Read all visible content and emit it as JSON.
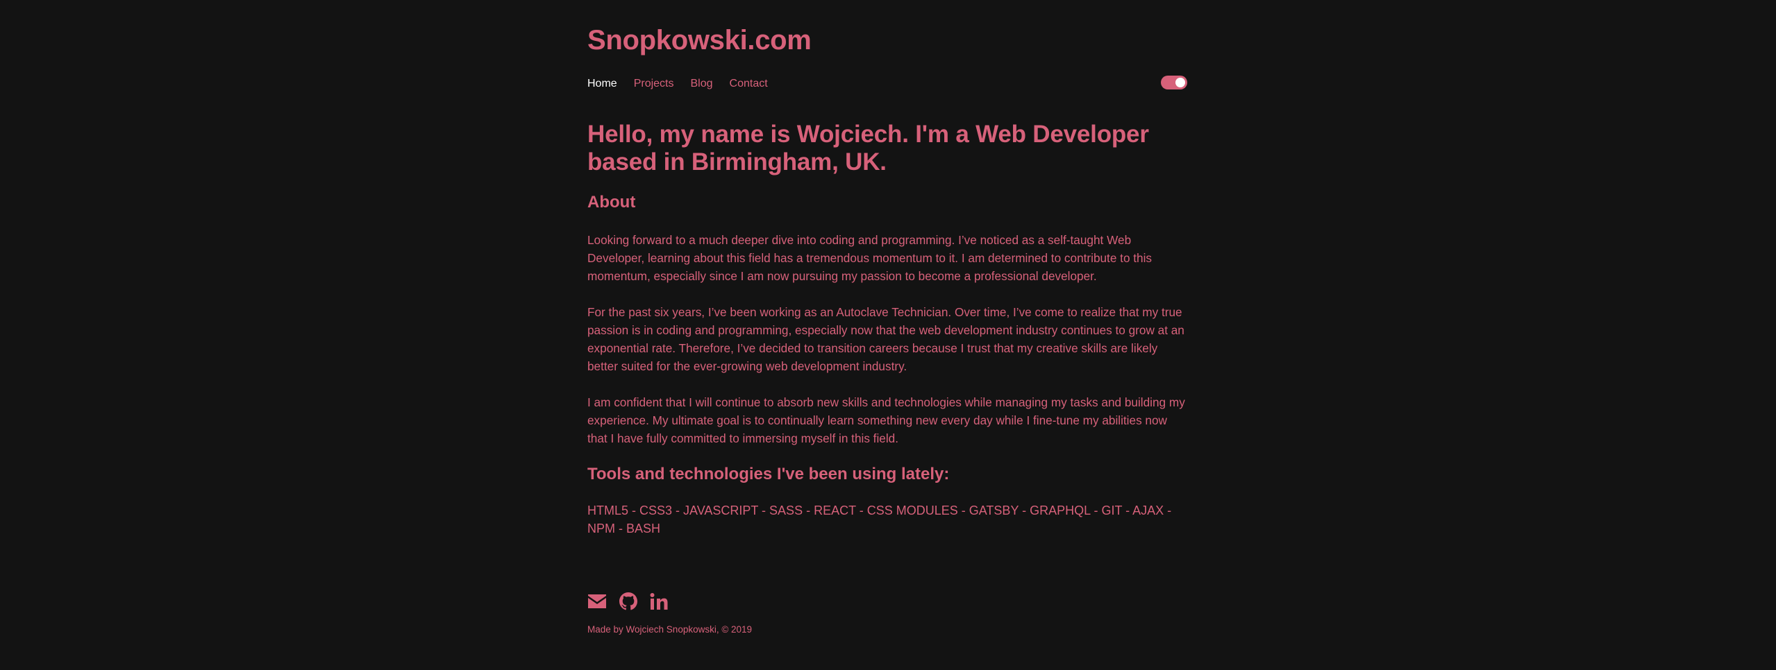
{
  "header": {
    "site_title": "Snopkowski.com"
  },
  "nav": {
    "items": [
      {
        "label": "Home",
        "active": true
      },
      {
        "label": "Projects",
        "active": false
      },
      {
        "label": "Blog",
        "active": false
      },
      {
        "label": "Contact",
        "active": false
      }
    ],
    "theme_toggle": {
      "state": "on",
      "color": "#d7617a"
    }
  },
  "main": {
    "headline": "Hello, my name is Wojciech. I'm a Web Developer based in Birmingham, UK.",
    "about_heading": "About",
    "paragraphs": [
      "Looking forward to a much deeper dive into coding and programming. I’ve noticed as a self-taught Web Developer, learning about this field has a tremendous momentum to it. I am determined to contribute to this momentum, especially since I am now pursuing my passion to become a professional developer.",
      "For the past six years, I’ve been working as an Autoclave Technician. Over time, I’ve come to realize that my true passion is in coding and programming, especially now that the web development industry continues to grow at an exponential rate. Therefore, I’ve decided to transition careers because I trust that my creative skills are likely better suited for the ever-growing web development industry.",
      "I am confident that I will continue to absorb new skills and technologies while managing my tasks and building my experience. My ultimate goal is to continually learn something new every day while I fine-tune my abilities now that I have fully committed to immersing myself in this field."
    ],
    "tools_heading": "Tools and technologies I've been using lately:",
    "tools_list": "HTML5 - CSS3 - JAVASCRIPT - SASS - REACT - CSS MODULES - GATSBY - GRAPHQL - GIT - AJAX - NPM - BASH"
  },
  "footer": {
    "social_icons": [
      "envelope-icon",
      "github-icon",
      "linkedin-icon"
    ],
    "credit": "Made by Wojciech Snopkowski, © 2019"
  },
  "colors": {
    "background": "#131313",
    "accent": "#d7617a",
    "active_nav": "#ffffff"
  }
}
